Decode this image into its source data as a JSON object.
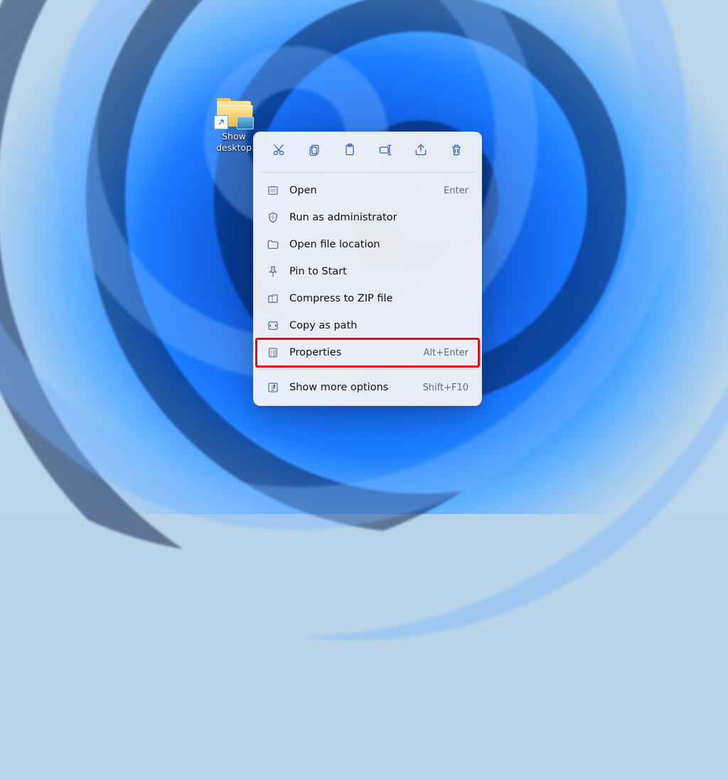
{
  "desktop": {
    "icon_label": "Show desktop",
    "icon_label_line1": "Show",
    "icon_label_line2": "desktop"
  },
  "context_menu": {
    "top_actions": [
      {
        "name": "cut-icon"
      },
      {
        "name": "copy-icon"
      },
      {
        "name": "paste-icon"
      },
      {
        "name": "rename-icon"
      },
      {
        "name": "share-icon"
      },
      {
        "name": "delete-icon"
      }
    ],
    "items": [
      {
        "icon": "open-icon",
        "label": "Open",
        "accel": "Enter"
      },
      {
        "icon": "shield-icon",
        "label": "Run as administrator",
        "accel": ""
      },
      {
        "icon": "folder-icon",
        "label": "Open file location",
        "accel": ""
      },
      {
        "icon": "pin-icon",
        "label": "Pin to Start",
        "accel": ""
      },
      {
        "icon": "zip-icon",
        "label": "Compress to ZIP file",
        "accel": ""
      },
      {
        "icon": "copy-path-icon",
        "label": "Copy as path",
        "accel": ""
      },
      {
        "icon": "properties-icon",
        "label": "Properties",
        "accel": "Alt+Enter",
        "highlight": true
      },
      {
        "separator": true
      },
      {
        "icon": "more-icon",
        "label": "Show more options",
        "accel": "Shift+F10"
      }
    ]
  },
  "highlight_color": "#e01010"
}
